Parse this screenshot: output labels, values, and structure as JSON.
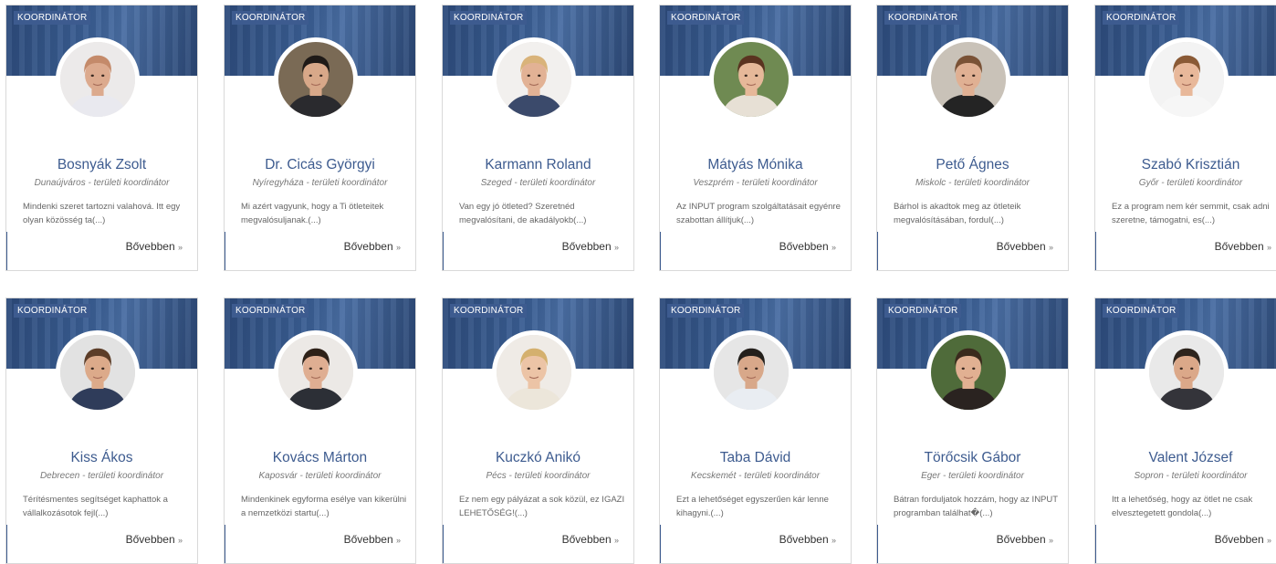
{
  "more_label": "Bővebben",
  "more_arrow": "»",
  "colors": {
    "accent": "#3d5b8f",
    "banner": "#2c4a7a"
  },
  "cards": [
    {
      "badge": "KOORDINÁTOR",
      "name": "Bosnyák Zsolt",
      "role": "Dunaújváros - területi koordinátor",
      "desc": "Mindenki szeret tartozni valahová. Itt egy olyan közösség ta(...)",
      "photo": {
        "bg": "#eceaea",
        "skin": "#dcaa8e",
        "hair": "#c48a6a",
        "shirt": "#e9e9ef"
      }
    },
    {
      "badge": "KOORDINÁTOR",
      "name": "Dr. Cicás Györgyi",
      "role": "Nyíregyháza - területi koordinátor",
      "desc": "Mi azért vagyunk, hogy a Ti ötleteitek megvalósuljanak.(...)",
      "photo": {
        "bg": "#7a6a55",
        "skin": "#d8a889",
        "hair": "#1f1a17",
        "shirt": "#2a2a2e"
      }
    },
    {
      "badge": "KOORDINÁTOR",
      "name": "Karmann Roland",
      "role": "Szeged - területi koordinátor",
      "desc": "Van egy jó ötleted? Szeretnéd megvalósítani, de akadályokb(...)",
      "photo": {
        "bg": "#f2f0ee",
        "skin": "#e2b295",
        "hair": "#d9b37a",
        "shirt": "#3b4a6b"
      }
    },
    {
      "badge": "KOORDINÁTOR",
      "name": "Mátyás Mónika",
      "role": "Veszprém - területi koordinátor",
      "desc": "Az INPUT program szolgáltatásait egyénre szabottan állítjuk(...)",
      "photo": {
        "bg": "#6f8a52",
        "skin": "#e6b899",
        "hair": "#5a3320",
        "shirt": "#e7e0d5"
      }
    },
    {
      "badge": "KOORDINÁTOR",
      "name": "Pető Ágnes",
      "role": "Miskolc - területi koordinátor",
      "desc": "Bárhol is akadtok meg az ötleteik megvalósításában, forduI(...)",
      "photo": {
        "bg": "#c9c2b8",
        "skin": "#e0b093",
        "hair": "#7a5236",
        "shirt": "#242424"
      }
    },
    {
      "badge": "KOORDINÁTOR",
      "name": "Szabó Krisztián",
      "role": "Győr - területi koordinátor",
      "desc": "Ez a program nem kér semmit, csak adni szeretne, támogatni, es(...)",
      "photo": {
        "bg": "#f3f3f3",
        "skin": "#e8b89a",
        "hair": "#8a5a36",
        "shirt": "#f6f6f6"
      }
    },
    {
      "badge": "KOORDINÁTOR",
      "name": "Kiss Ákos",
      "role": "Debrecen - területi koordinátor",
      "desc": "Térítésmentes segítséget kaphattok a vállalkozásotok fejl(...)",
      "photo": {
        "bg": "#e2e2e2",
        "skin": "#dcaa8a",
        "hair": "#5c3d28",
        "shirt": "#2f3c5a"
      }
    },
    {
      "badge": "KOORDINÁTOR",
      "name": "Kovács Márton",
      "role": "Kaposvár - területi koordinátor",
      "desc": "Mindenkinek egyforma esélye van kikerülni a nemzetközi startu(...)",
      "photo": {
        "bg": "#ece9e6",
        "skin": "#dfae92",
        "hair": "#2e2118",
        "shirt": "#2c2f36"
      }
    },
    {
      "badge": "KOORDINÁTOR",
      "name": "Kuczkó Anikó",
      "role": "Pécs - területi koordinátor",
      "desc": "Ez nem egy pályázat a sok közül, ez IGAZI LEHETŐSÉG!(...)",
      "photo": {
        "bg": "#efebe6",
        "skin": "#ecc4a6",
        "hair": "#d4b06e",
        "shirt": "#ece6da"
      }
    },
    {
      "badge": "KOORDINÁTOR",
      "name": "Taba Dávid",
      "role": "Kecskemét - területi koordinátor",
      "desc": "Ezt a lehetőséget egyszerűen kár lenne kihagyni.(...)",
      "photo": {
        "bg": "#e6e6e6",
        "skin": "#d8a88a",
        "hair": "#24201c",
        "shirt": "#e9edf2"
      }
    },
    {
      "badge": "KOORDINÁTOR",
      "name": "Törőcsik Gábor",
      "role": "Eger - területi koordinátor",
      "desc": "Bátran forduljatok hozzám, hogy az INPUT programban találhat�(...)",
      "photo": {
        "bg": "#4f6b3a",
        "skin": "#e1b092",
        "hair": "#3a2a1d",
        "shirt": "#2a2320"
      }
    },
    {
      "badge": "KOORDINÁTOR",
      "name": "Valent József",
      "role": "Sopron - területi koordinátor",
      "desc": "Itt a lehetőség, hogy az ötlet ne csak elvesztegetett gondola(...)",
      "photo": {
        "bg": "#e9e9e9",
        "skin": "#dba889",
        "hair": "#2d241d",
        "shirt": "#34343a"
      }
    }
  ]
}
